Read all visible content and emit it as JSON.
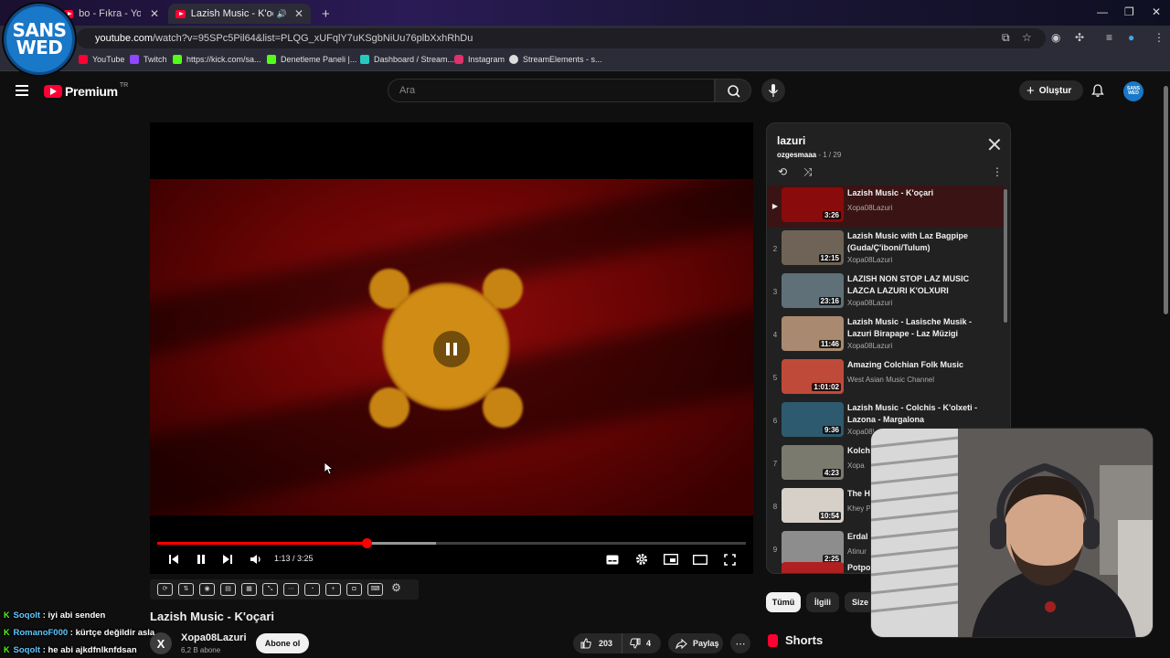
{
  "browser": {
    "tabs": [
      {
        "title": "bo - Fıkra - YouTube",
        "active": false
      },
      {
        "title": "Lazish Music - K'oçari - You",
        "active": true
      }
    ],
    "url_host": "youtube.com",
    "url_rest": "/watch?v=95SPc5Pil64&list=PLQG_xUFqlY7uKSgbNiUu76plbXxhRhDu",
    "bookmarks": [
      "YouTube",
      "Twitch",
      "https://kick.com/sa...",
      "Denetleme Paneli |...",
      "Dashboard / Stream...",
      "Instagram",
      "StreamElements - s..."
    ]
  },
  "overlay_logo": {
    "line1": "SANS",
    "line2": "WED"
  },
  "masthead": {
    "logo_text": "Premium",
    "country": "TR",
    "search_placeholder": "Ara",
    "create_label": "Oluştur",
    "avatar_line1": "SANS",
    "avatar_line2": "WED"
  },
  "player": {
    "time": "1:13 / 3:25",
    "progress_fraction": 0.356,
    "buffered_fraction": 0.473,
    "paused_indicator": "pause"
  },
  "video": {
    "title": "Lazish Music - K'oçari",
    "channel": "Xopa08Lazuri",
    "channel_initial": "X",
    "subscribers": "6,2 B abone",
    "subscribe_label": "Abone ol",
    "likes": "203",
    "dislikes": "4",
    "share_label": "Paylaş"
  },
  "playlist": {
    "title": "lazuri",
    "owner": "ozgesmaaa",
    "position": "1 / 29",
    "items": [
      {
        "index": "▶",
        "title": "Lazish Music - K'oçari",
        "channel": "Xopa08Lazuri",
        "duration": "3:26",
        "thumb": "#8a0b0b"
      },
      {
        "index": "2",
        "title": "Lazish Music with Laz Bagpipe (Guda/Ç'iboni/Tulum)",
        "channel": "Xopa08Lazuri",
        "duration": "12:15",
        "thumb": "#6f6357"
      },
      {
        "index": "3",
        "title": "LAZISH NON STOP LAZ MUSIC LAZCA LAZURI K'OLXURI",
        "channel": "Xopa08Lazuri",
        "duration": "23:16",
        "thumb": "#5f7078"
      },
      {
        "index": "4",
        "title": "Lazish Music - Lasische Musik - Lazuri Birapape - Laz Müzigi",
        "channel": "Xopa08Lazuri",
        "duration": "11:46",
        "thumb": "#a98a70"
      },
      {
        "index": "5",
        "title": "Amazing Colchian Folk Music",
        "channel": "West Asian Music Channel",
        "duration": "1:01:02",
        "thumb": "#c04a3a"
      },
      {
        "index": "6",
        "title": "Lazish Music - Colchis - K'olxeti - Lazona - Margalona",
        "channel": "Xopa08Lazuri",
        "duration": "9:36",
        "thumb": "#2d5a6e"
      },
      {
        "index": "7",
        "title": "Kolch",
        "channel": "Xopa",
        "duration": "4:23",
        "thumb": "#7a7a6e"
      },
      {
        "index": "8",
        "title": "The H",
        "channel": "Khey P",
        "duration": "10:54",
        "thumb": "#d6d0c8"
      },
      {
        "index": "9",
        "title": "Erdal",
        "channel": "Atinur",
        "duration": "2:25",
        "thumb": "#8d8d8d"
      },
      {
        "index": "",
        "title": "Potpo",
        "channel": "",
        "duration": "",
        "thumb": "#b02020"
      }
    ]
  },
  "chips": [
    "Tümü",
    "İlgili",
    "Size"
  ],
  "shorts_label": "Shorts",
  "chat": [
    {
      "user": "Soqolt",
      "message": ": iyi abi senden"
    },
    {
      "user": "RomanoF000",
      "message": ": kürtçe değildir asla"
    },
    {
      "user": "Soqolt",
      "message": ": he abi ajkdfnlknfdsan"
    }
  ],
  "colors": {
    "accent_red": "#ff0000",
    "brand_red": "#ff0033",
    "streamer_blue": "#1978c8",
    "kick_green": "#53fc18"
  }
}
